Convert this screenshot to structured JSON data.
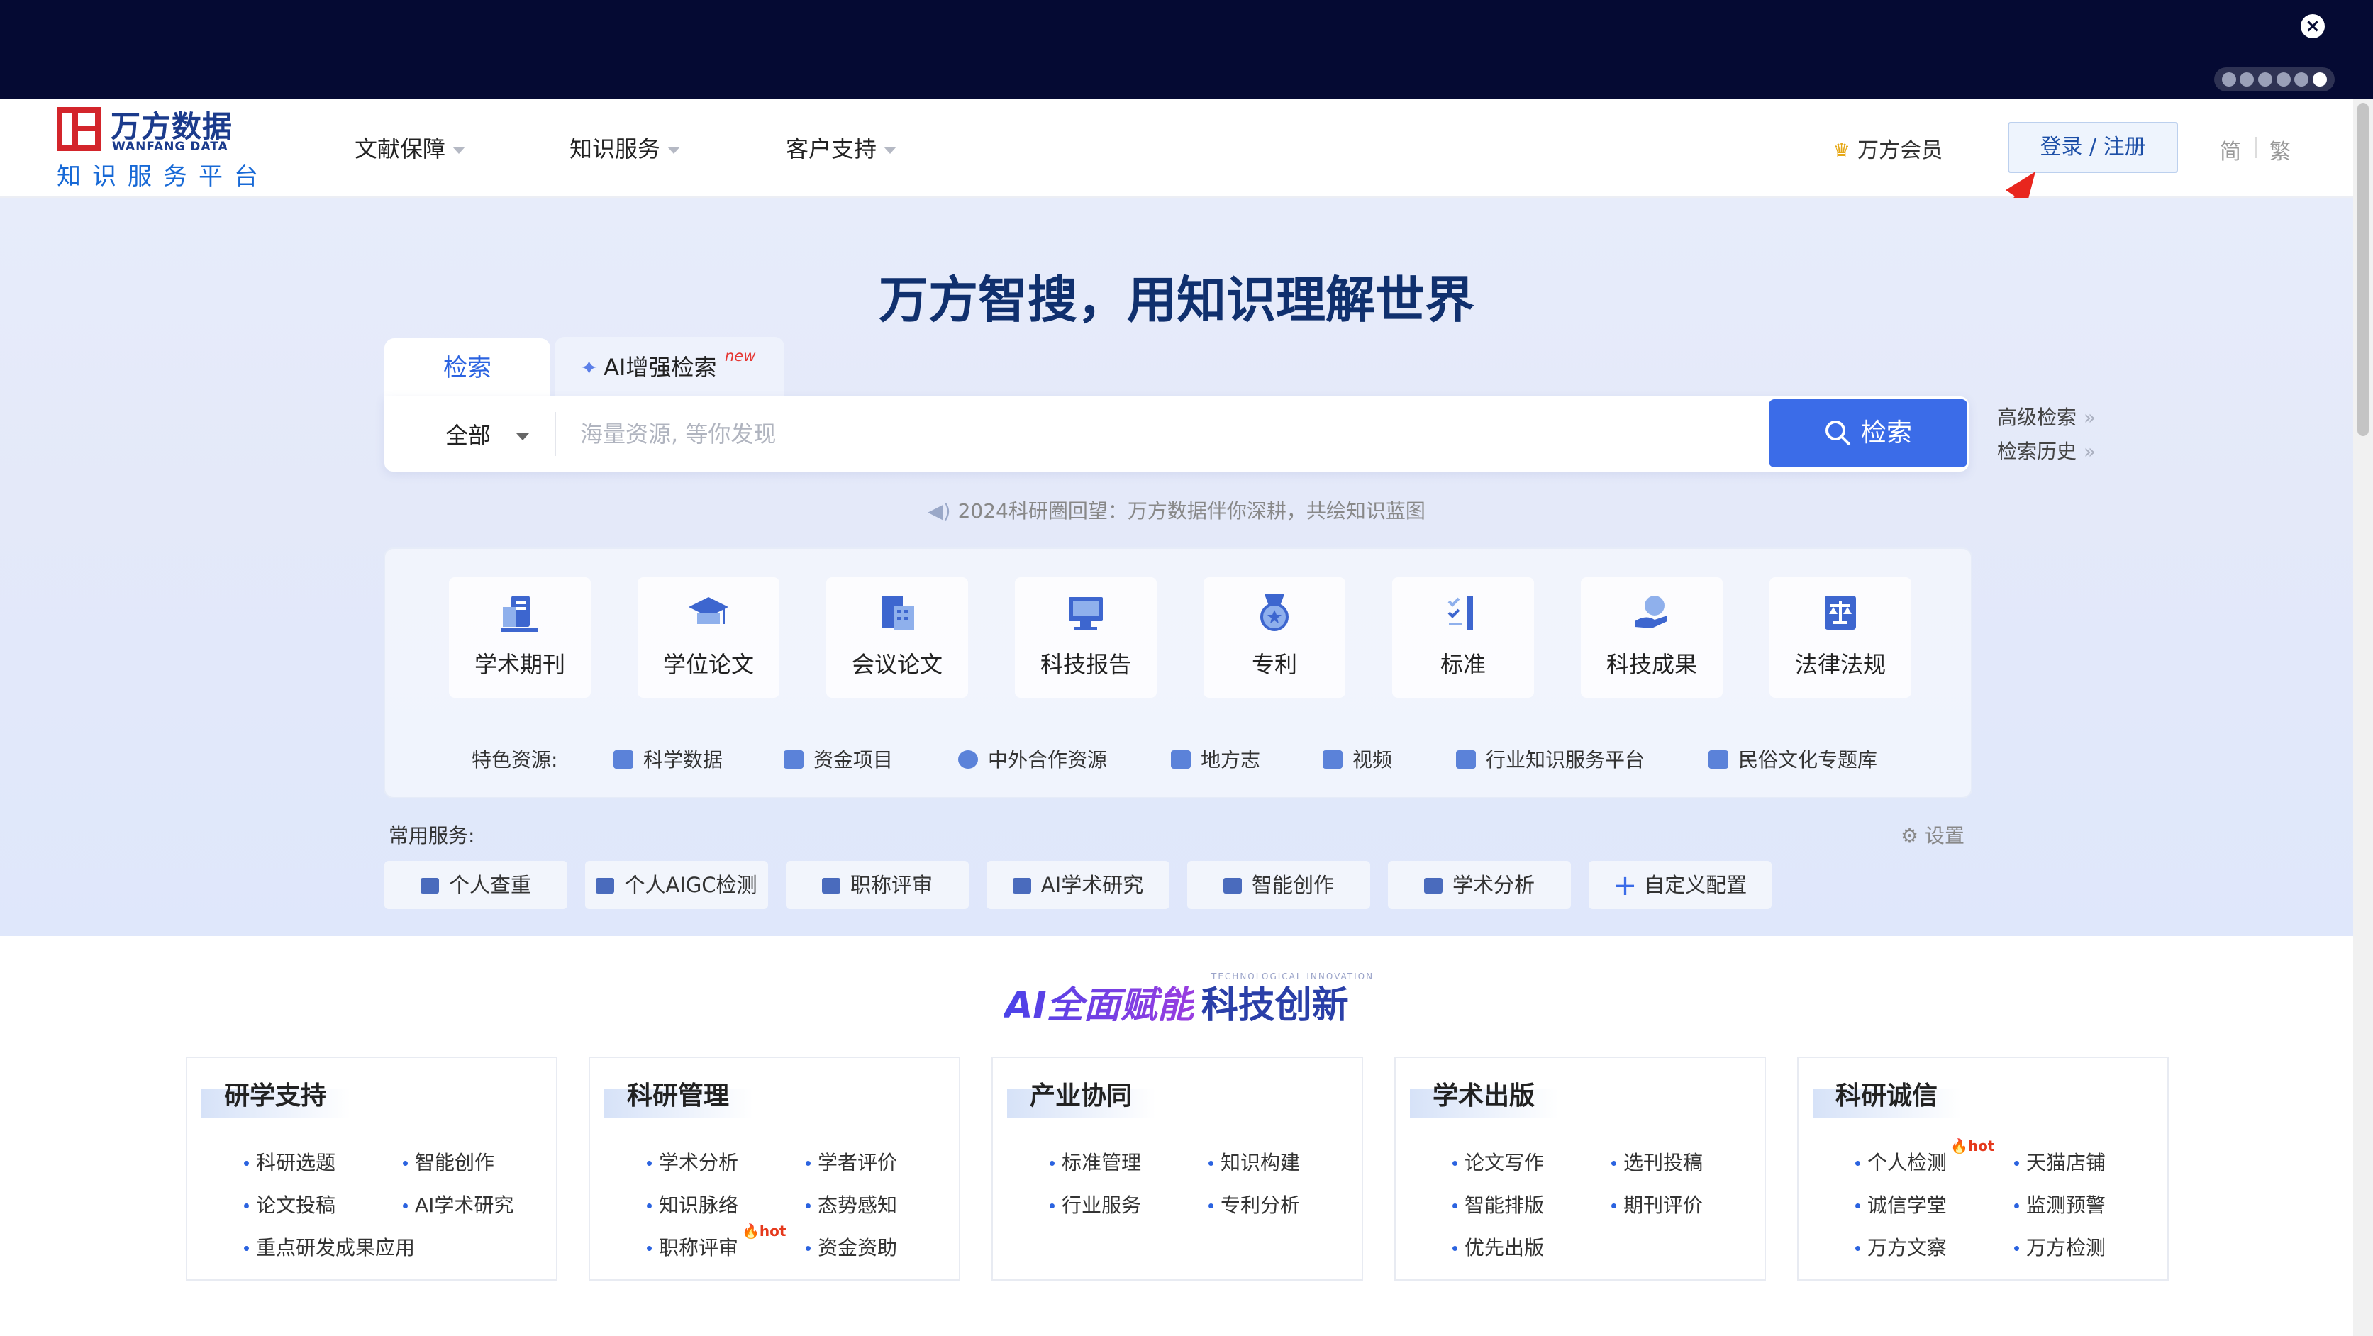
{
  "window": {
    "close_icon": "×"
  },
  "nav": {
    "logo_cn": "万方数据",
    "logo_en": "WANFANG DATA",
    "logo_sub": "知识服务平台",
    "menu": [
      {
        "label": "文献保障"
      },
      {
        "label": "知识服务"
      },
      {
        "label": "客户支持"
      }
    ],
    "vip_label": "万方会员",
    "login_label": "登录 / 注册",
    "lang_simplified": "简",
    "lang_traditional": "繁"
  },
  "hero": {
    "title": "万方智搜，用知识理解世界",
    "tab_search": "检索",
    "tab_ai": "AI增强检索",
    "tab_ai_badge": "new",
    "scope_selected": "全部",
    "search_placeholder": "海量资源, 等你发现",
    "search_button": "检索",
    "advanced_search": "高级检索",
    "search_history": "检索历史",
    "notice": "2024科研圈回望：万方数据伴你深耕，共绘知识蓝图"
  },
  "resources": [
    {
      "label": "学术期刊",
      "icon": "journal-icon"
    },
    {
      "label": "学位论文",
      "icon": "graduation-cap-icon"
    },
    {
      "label": "会议论文",
      "icon": "conference-icon"
    },
    {
      "label": "科技报告",
      "icon": "report-icon"
    },
    {
      "label": "专利",
      "icon": "medal-icon"
    },
    {
      "label": "标准",
      "icon": "checklist-icon"
    },
    {
      "label": "科技成果",
      "icon": "achievement-icon"
    },
    {
      "label": "法律法规",
      "icon": "law-scale-icon"
    }
  ],
  "featured": {
    "label": "特色资源:",
    "items": [
      "科学数据",
      "资金项目",
      "中外合作资源",
      "地方志",
      "视频",
      "行业知识服务平台",
      "民俗文化专题库"
    ]
  },
  "common_services": {
    "label": "常用服务:",
    "settings": "设置",
    "items": [
      "个人查重",
      "个人AIGC检测",
      "职称评审",
      "AI学术研究",
      "智能创作",
      "学术分析"
    ],
    "custom": "自定义配置"
  },
  "ai_section": {
    "title_part1": "AI全面赋能",
    "title_part2": "科技创新",
    "small_caption": "TECHNOLOGICAL INNOVATION"
  },
  "categories": [
    {
      "title": "研学支持",
      "items": [
        "科研选题",
        "智能创作",
        "论文投稿",
        "AI学术研究",
        "重点研发成果应用"
      ]
    },
    {
      "title": "科研管理",
      "items": [
        "学术分析",
        "学者评价",
        "知识脉络",
        "态势感知",
        "职称评审",
        "资金资助"
      ]
    },
    {
      "title": "产业协同",
      "items": [
        "标准管理",
        "知识构建",
        "行业服务",
        "专利分析"
      ]
    },
    {
      "title": "学术出版",
      "items": [
        "论文写作",
        "选刊投稿",
        "智能排版",
        "期刊评价",
        "优先出版"
      ]
    },
    {
      "title": "科研诚信",
      "items": [
        "个人检测",
        "天猫店铺",
        "诚信学堂",
        "监测预警",
        "万方文察",
        "万方检测"
      ]
    }
  ],
  "hot_badge": "hot",
  "colors": {
    "topbar": "#050a33",
    "brand_red": "#d3252b",
    "brand_blue": "#1b3b8c",
    "accent": "#3b6ce8",
    "annotation_arrow": "#e8261e"
  }
}
